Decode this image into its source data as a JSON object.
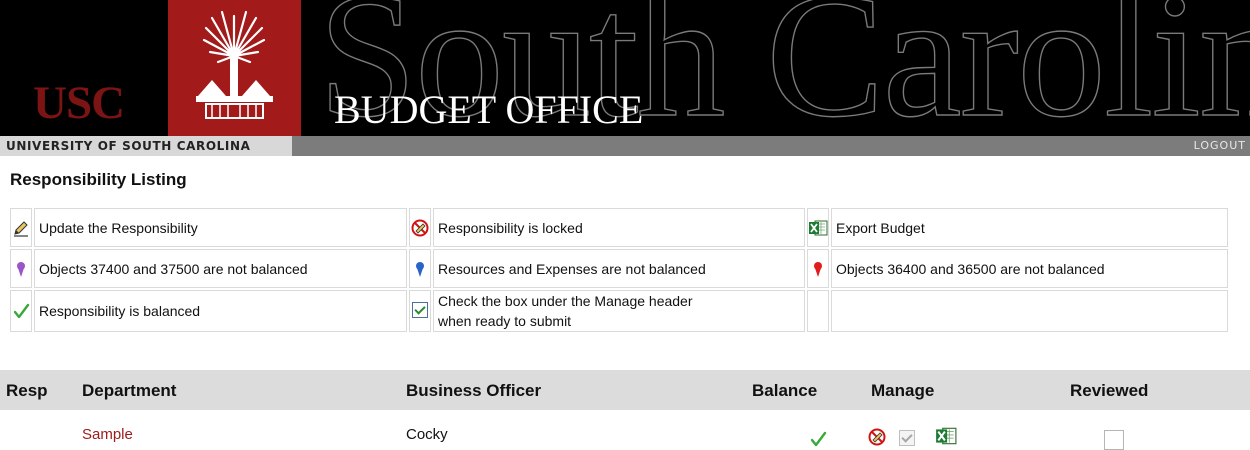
{
  "header": {
    "short_name": "USC",
    "office_title": "BUDGET OFFICE",
    "watermark": "South Carolina",
    "university": "UNIVERSITY OF SOUTH CAROLINA",
    "logout": "LOGOUT"
  },
  "page_title": "Responsibility Listing",
  "legend": {
    "update": "Update the Responsibility",
    "locked": "Responsibility is locked",
    "export": "Export Budget",
    "objects_37400": "Objects 37400 and 37500 are not balanced",
    "res_exp": "Resources and Expenses are not balanced",
    "objects_36400": "Objects 36400 and 36500 are not balanced",
    "balanced": "Responsibility is balanced",
    "manage_line1": "Check the box under the Manage header",
    "manage_line2": "when ready to submit"
  },
  "table": {
    "headers": {
      "resp": "Resp",
      "department": "Department",
      "officer": "Business Officer",
      "balance": "Balance",
      "manage": "Manage",
      "reviewed": "Reviewed"
    },
    "rows": [
      {
        "department": "Sample",
        "officer": "Cocky"
      }
    ]
  },
  "colors": {
    "brand_red": "#a21a1a",
    "link_red": "#9b1c1c",
    "check_green": "#3aa93a",
    "pin_purple": "#9a55c8",
    "pin_blue": "#2a64c8",
    "pin_red": "#e01c1c"
  }
}
